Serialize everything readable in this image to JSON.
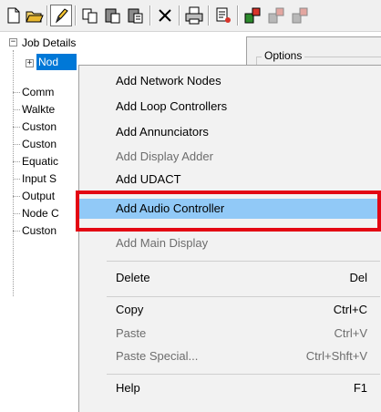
{
  "toolbar": {
    "buttons": [
      {
        "icon": "new-document-icon"
      },
      {
        "icon": "open-folder-icon"
      },
      {
        "icon": "edit-pencil-icon",
        "pressed": true
      },
      {
        "icon": "copy-icon"
      },
      {
        "icon": "paste-icon"
      },
      {
        "icon": "paste-special-icon"
      },
      {
        "icon": "delete-x-icon"
      },
      {
        "icon": "print-icon"
      },
      {
        "icon": "properties-icon"
      },
      {
        "icon": "download-to-panel-icon"
      },
      {
        "icon": "upload-from-panel-icon"
      },
      {
        "icon": "compare-icon"
      }
    ]
  },
  "tree": {
    "root": {
      "label": "Job Details",
      "expander": "−"
    },
    "selected": {
      "label": "Nod",
      "expander": "+"
    },
    "items": [
      "Comm",
      "Walkte",
      "Custon",
      "Custon",
      "Equatic",
      "Input S",
      "Output",
      "Node C",
      "Custon"
    ]
  },
  "options_panel": {
    "legend": "Options"
  },
  "context_menu": {
    "highlight_color": "#91c9f7",
    "annotation_color": "#e30613",
    "items": [
      {
        "label": "Add Network Nodes",
        "shortcut": "",
        "disabled": false
      },
      {
        "label": "Add Loop Controllers",
        "shortcut": "",
        "disabled": false
      },
      {
        "label": "Add Annunciators",
        "shortcut": "",
        "disabled": false
      },
      {
        "label": "Add Display Adder",
        "shortcut": "",
        "disabled": true
      },
      {
        "label": "Add UDACT",
        "shortcut": "",
        "disabled": false
      },
      {
        "label": "Add Audio Controller",
        "shortcut": "",
        "disabled": false,
        "highlighted": true
      },
      {
        "label": "Add Main Display",
        "shortcut": "",
        "disabled": true
      },
      {
        "label": "Delete",
        "shortcut": "Del",
        "disabled": false
      },
      {
        "label": "Copy",
        "shortcut": "Ctrl+C",
        "disabled": false
      },
      {
        "label": "Paste",
        "shortcut": "Ctrl+V",
        "disabled": true
      },
      {
        "label": "Paste Special...",
        "shortcut": "Ctrl+Shft+V",
        "disabled": true
      },
      {
        "label": "Help",
        "shortcut": "F1",
        "disabled": false
      }
    ]
  }
}
